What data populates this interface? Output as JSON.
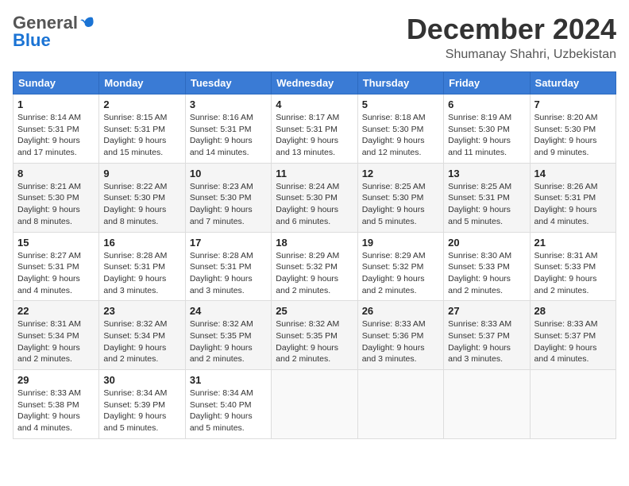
{
  "logo": {
    "general": "General",
    "blue": "Blue"
  },
  "title": "December 2024",
  "subtitle": "Shumanay Shahri, Uzbekistan",
  "days_header": [
    "Sunday",
    "Monday",
    "Tuesday",
    "Wednesday",
    "Thursday",
    "Friday",
    "Saturday"
  ],
  "weeks": [
    [
      {
        "day": "1",
        "info": "Sunrise: 8:14 AM\nSunset: 5:31 PM\nDaylight: 9 hours and 17 minutes."
      },
      {
        "day": "2",
        "info": "Sunrise: 8:15 AM\nSunset: 5:31 PM\nDaylight: 9 hours and 15 minutes."
      },
      {
        "day": "3",
        "info": "Sunrise: 8:16 AM\nSunset: 5:31 PM\nDaylight: 9 hours and 14 minutes."
      },
      {
        "day": "4",
        "info": "Sunrise: 8:17 AM\nSunset: 5:31 PM\nDaylight: 9 hours and 13 minutes."
      },
      {
        "day": "5",
        "info": "Sunrise: 8:18 AM\nSunset: 5:30 PM\nDaylight: 9 hours and 12 minutes."
      },
      {
        "day": "6",
        "info": "Sunrise: 8:19 AM\nSunset: 5:30 PM\nDaylight: 9 hours and 11 minutes."
      },
      {
        "day": "7",
        "info": "Sunrise: 8:20 AM\nSunset: 5:30 PM\nDaylight: 9 hours and 9 minutes."
      }
    ],
    [
      {
        "day": "8",
        "info": "Sunrise: 8:21 AM\nSunset: 5:30 PM\nDaylight: 9 hours and 8 minutes."
      },
      {
        "day": "9",
        "info": "Sunrise: 8:22 AM\nSunset: 5:30 PM\nDaylight: 9 hours and 8 minutes."
      },
      {
        "day": "10",
        "info": "Sunrise: 8:23 AM\nSunset: 5:30 PM\nDaylight: 9 hours and 7 minutes."
      },
      {
        "day": "11",
        "info": "Sunrise: 8:24 AM\nSunset: 5:30 PM\nDaylight: 9 hours and 6 minutes."
      },
      {
        "day": "12",
        "info": "Sunrise: 8:25 AM\nSunset: 5:30 PM\nDaylight: 9 hours and 5 minutes."
      },
      {
        "day": "13",
        "info": "Sunrise: 8:25 AM\nSunset: 5:31 PM\nDaylight: 9 hours and 5 minutes."
      },
      {
        "day": "14",
        "info": "Sunrise: 8:26 AM\nSunset: 5:31 PM\nDaylight: 9 hours and 4 minutes."
      }
    ],
    [
      {
        "day": "15",
        "info": "Sunrise: 8:27 AM\nSunset: 5:31 PM\nDaylight: 9 hours and 4 minutes."
      },
      {
        "day": "16",
        "info": "Sunrise: 8:28 AM\nSunset: 5:31 PM\nDaylight: 9 hours and 3 minutes."
      },
      {
        "day": "17",
        "info": "Sunrise: 8:28 AM\nSunset: 5:31 PM\nDaylight: 9 hours and 3 minutes."
      },
      {
        "day": "18",
        "info": "Sunrise: 8:29 AM\nSunset: 5:32 PM\nDaylight: 9 hours and 2 minutes."
      },
      {
        "day": "19",
        "info": "Sunrise: 8:29 AM\nSunset: 5:32 PM\nDaylight: 9 hours and 2 minutes."
      },
      {
        "day": "20",
        "info": "Sunrise: 8:30 AM\nSunset: 5:33 PM\nDaylight: 9 hours and 2 minutes."
      },
      {
        "day": "21",
        "info": "Sunrise: 8:31 AM\nSunset: 5:33 PM\nDaylight: 9 hours and 2 minutes."
      }
    ],
    [
      {
        "day": "22",
        "info": "Sunrise: 8:31 AM\nSunset: 5:34 PM\nDaylight: 9 hours and 2 minutes."
      },
      {
        "day": "23",
        "info": "Sunrise: 8:32 AM\nSunset: 5:34 PM\nDaylight: 9 hours and 2 minutes."
      },
      {
        "day": "24",
        "info": "Sunrise: 8:32 AM\nSunset: 5:35 PM\nDaylight: 9 hours and 2 minutes."
      },
      {
        "day": "25",
        "info": "Sunrise: 8:32 AM\nSunset: 5:35 PM\nDaylight: 9 hours and 2 minutes."
      },
      {
        "day": "26",
        "info": "Sunrise: 8:33 AM\nSunset: 5:36 PM\nDaylight: 9 hours and 3 minutes."
      },
      {
        "day": "27",
        "info": "Sunrise: 8:33 AM\nSunset: 5:37 PM\nDaylight: 9 hours and 3 minutes."
      },
      {
        "day": "28",
        "info": "Sunrise: 8:33 AM\nSunset: 5:37 PM\nDaylight: 9 hours and 4 minutes."
      }
    ],
    [
      {
        "day": "29",
        "info": "Sunrise: 8:33 AM\nSunset: 5:38 PM\nDaylight: 9 hours and 4 minutes."
      },
      {
        "day": "30",
        "info": "Sunrise: 8:34 AM\nSunset: 5:39 PM\nDaylight: 9 hours and 5 minutes."
      },
      {
        "day": "31",
        "info": "Sunrise: 8:34 AM\nSunset: 5:40 PM\nDaylight: 9 hours and 5 minutes."
      },
      null,
      null,
      null,
      null
    ]
  ]
}
